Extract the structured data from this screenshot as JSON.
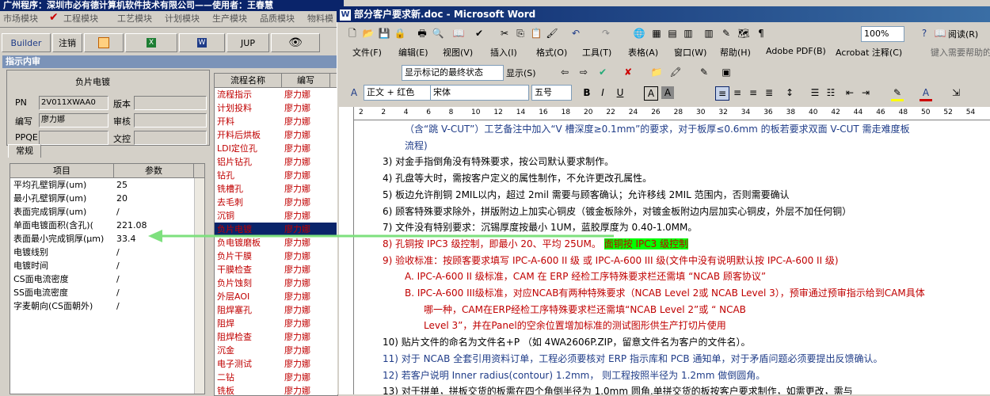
{
  "app": {
    "title": "广州程序：深圳市必有德计算机软件技术有限公司——使用者：王春慧",
    "menu": [
      "市场模块",
      "工程模块",
      "工艺模块",
      "计划模块",
      "生产模块",
      "品质模块",
      "物料模"
    ],
    "toolbar": {
      "builder": "Builder",
      "logout": "注销",
      "jup": "JUP"
    },
    "panel_title": "指示内审",
    "info": {
      "title": "负片电镀",
      "pn_label": "PN",
      "pn_value": "2V011XWAA0",
      "version_label": "版本",
      "version_value": "",
      "editor_label": "编写",
      "editor_value": "廖力娜",
      "review_label": "审核",
      "review_value": "",
      "ppqe_label": "PPQE",
      "ppqe_value": "",
      "doc_label": "文控",
      "doc_value": ""
    },
    "tab_general": "常规",
    "param_headers": [
      "项目",
      "参数"
    ],
    "params": [
      {
        "name": "平均孔壁铜厚(um)",
        "value": "25"
      },
      {
        "name": "最小孔壁铜厚(um)",
        "value": "20"
      },
      {
        "name": "表面完成铜厚(um)",
        "value": "/"
      },
      {
        "name": "单面电镀面积(含孔)(",
        "value": "221.08"
      },
      {
        "name": "表面最小完成铜厚(μm)",
        "value": "33.4"
      },
      {
        "name": "电镀线别",
        "value": "/"
      },
      {
        "name": "电镀时间",
        "value": "/"
      },
      {
        "name": "CS面电流密度",
        "value": "/"
      },
      {
        "name": "SS面电流密度",
        "value": "/"
      },
      {
        "name": "字麦朝向(CS面朝外)",
        "value": "/"
      }
    ],
    "process_headers": [
      "流程名称",
      "编写"
    ],
    "processes": [
      {
        "name": "流程指示",
        "owner": "廖力娜"
      },
      {
        "name": "计划投料",
        "owner": "廖力娜"
      },
      {
        "name": "开料",
        "owner": "廖力娜"
      },
      {
        "name": "开料后烘板",
        "owner": "廖力娜"
      },
      {
        "name": "LDI定位孔",
        "owner": "廖力娜"
      },
      {
        "name": "铝片钻孔",
        "owner": "廖力娜"
      },
      {
        "name": "钻孔",
        "owner": "廖力娜"
      },
      {
        "name": "铣槽孔",
        "owner": "廖力娜"
      },
      {
        "name": "去毛刺",
        "owner": "廖力娜"
      },
      {
        "name": "沉铜",
        "owner": "廖力娜"
      },
      {
        "name": "负片电镀",
        "owner": "廖力娜",
        "selected": true
      },
      {
        "name": "负电镀磨板",
        "owner": "廖力娜"
      },
      {
        "name": "负片干膜",
        "owner": "廖力娜"
      },
      {
        "name": "干膜检查",
        "owner": "廖力娜"
      },
      {
        "name": "负片蚀刻",
        "owner": "廖力娜"
      },
      {
        "name": "外层AOI",
        "owner": "廖力娜"
      },
      {
        "name": "阻焊塞孔",
        "owner": "廖力娜"
      },
      {
        "name": "阻焊",
        "owner": "廖力娜"
      },
      {
        "name": "阻焊检查",
        "owner": "廖力娜"
      },
      {
        "name": "沉金",
        "owner": "廖力娜"
      },
      {
        "name": "电子测试",
        "owner": "廖力娜"
      },
      {
        "name": "二钻",
        "owner": "廖力娜"
      },
      {
        "name": "铣板",
        "owner": "廖力娜"
      }
    ]
  },
  "word": {
    "title": "部分客户要求新.doc - Microsoft Word",
    "zoom": "100%",
    "reading": "阅读(R)",
    "menu": [
      "文件(F)",
      "编辑(E)",
      "视图(V)",
      "插入(I)",
      "格式(O)",
      "工具(T)",
      "表格(A)",
      "窗口(W)",
      "帮助(H)",
      "Adobe PDF(B)",
      "Acrobat 注释(C)"
    ],
    "help_placeholder": "键入需要帮助的",
    "markup_combo": "显示标记的最终状态",
    "show_label": "显示(S)",
    "style_combo": "正文 + 红色",
    "font_combo": "宋体",
    "size_combo": "五号",
    "ruler_numbers": [
      "2",
      "2",
      "4",
      "6",
      "8",
      "10",
      "12",
      "14",
      "16",
      "18",
      "20",
      "22",
      "24",
      "26",
      "28",
      "30",
      "32",
      "34",
      "36",
      "38",
      "40",
      "42",
      "44",
      "46",
      "48",
      "50",
      "52",
      "54"
    ],
    "lines": [
      {
        "text": "（含“跳 V-CUT”）工艺备注中加入“V 槽深度≥0.1mm”的要求，对于板厚≤0.6mm 的板若要求双面 V-CUT 需走难度板",
        "color": "blue",
        "indent": 64
      },
      {
        "text": "流程)",
        "color": "blue",
        "indent": 64
      },
      {
        "text": "3)   对金手指倒角没有特殊要求，按公司默认要求制作。",
        "color": "dark",
        "indent": 36
      },
      {
        "text": "4)   孔盘等大时，需按客户定义的属性制作，不允许更改孔属性。",
        "color": "dark",
        "indent": 36
      },
      {
        "text": "5)   板边允许削铜 2MIL以内，超过 2mil 需要与顾客确认；允许移线 2MIL 范围内，否则需要确认",
        "color": "dark",
        "indent": 36
      },
      {
        "text": "6)   顾客特殊要求除外，拼版附边上加实心铜皮（镀金板除外，对镀金板附边内层加实心铜皮，外层不加任何铜）",
        "color": "dark",
        "indent": 36
      },
      {
        "text": "7)   文件没有特别要求：沉锡厚度按最小 1UM，蓝胶厚度为 0.40-1.0MM。",
        "color": "dark",
        "indent": 36
      },
      {
        "text": "8)   孔铜按 IPC3 级控制，即最小 20、平均 25UM。",
        "color": "red",
        "indent": 36,
        "highlight": "面铜按 IPC3 级控制"
      },
      {
        "text": "9)   验收标准：按顾客要求填写 IPC-A-600 II 级 或 IPC-A-600 III 级(文件中没有说明默认按 IPC-A-600 II 级)",
        "color": "red",
        "indent": 36
      },
      {
        "text": "A.  IPC-A-600 II 级标准，CAM 在 ERP 经检工序特殊要求栏还需填 “NCAB 顾客协议”",
        "color": "red",
        "indent": 64
      },
      {
        "text": "B.  IPC-A-600 III级标准，对应NCAB有两种特殊要求（NCAB Level 2或 NCAB Level 3），预审通过预审指示给到CAM具体",
        "color": "red",
        "indent": 64
      },
      {
        "text": "哪一种，CAM在ERP经检工序特殊要求栏还需填“NCAB Level 2”或 “ NCAB",
        "color": "red",
        "indent": 88
      },
      {
        "text": "Level 3”，并在Panel的空余位置增加标准的测试图形供生产打切片使用",
        "color": "red",
        "indent": 88
      },
      {
        "text": "10) 贴片文件的命名为文件名+P （如 4WA2606P.ZIP，留意文件名为客户的文件名）。",
        "color": "dark",
        "indent": 36
      },
      {
        "text": "11) 对于 NCAB 全套引用资料订单，工程必须要核对 ERP 指示库和 PCB 通知单，对于矛盾问题必须要提出反馈确认。",
        "color": "blue",
        "indent": 36
      },
      {
        "text": "12) 若客户说明 Inner radius(contour) 1.2mm，    则工程按照半径为 1.2mm 做倒圆角。",
        "color": "blue",
        "indent": 36
      },
      {
        "text": "13) 对于拼单，拼板交货的板需在四个角倒半径为 1.0mm 圆角,单拼交货的板按客户要求制作，如需更改，需与",
        "color": "dark",
        "indent": 36
      }
    ]
  }
}
